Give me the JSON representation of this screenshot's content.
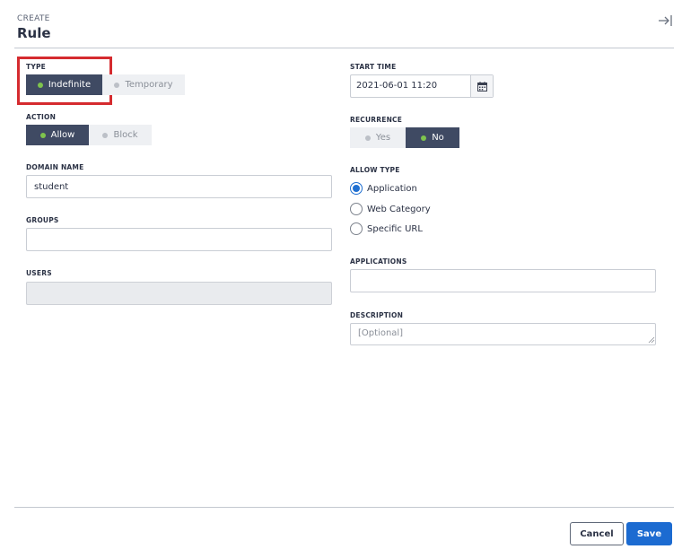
{
  "header": {
    "eyebrow": "CREATE",
    "title": "Rule",
    "collapse_icon": "collapse-right-icon"
  },
  "left": {
    "type": {
      "label": "TYPE",
      "options": [
        "Indefinite",
        "Temporary"
      ],
      "selected": "Indefinite"
    },
    "action": {
      "label": "ACTION",
      "options": [
        "Allow",
        "Block"
      ],
      "selected": "Allow"
    },
    "domain_name": {
      "label": "DOMAIN NAME",
      "value": "student"
    },
    "groups": {
      "label": "GROUPS",
      "value": ""
    },
    "users": {
      "label": "USERS",
      "value": "",
      "disabled": true
    }
  },
  "right": {
    "start_time": {
      "label": "START TIME",
      "value": "2021-06-01 11:20",
      "icon": "calendar-icon"
    },
    "recurrence": {
      "label": "RECURRENCE",
      "options": [
        "Yes",
        "No"
      ],
      "selected": "No"
    },
    "allow_type": {
      "label": "ALLOW TYPE",
      "options": [
        "Application",
        "Web Category",
        "Specific URL"
      ],
      "selected": "Application"
    },
    "applications": {
      "label": "APPLICATIONS",
      "value": ""
    },
    "description": {
      "label": "DESCRIPTION",
      "placeholder": "[Optional]"
    }
  },
  "footer": {
    "cancel_label": "Cancel",
    "save_label": "Save"
  },
  "colors": {
    "accent": "#1c6bd1",
    "toggle_on": "#3f4a63",
    "highlight": "#d52b2f",
    "status_dot": "#7ec44d"
  }
}
